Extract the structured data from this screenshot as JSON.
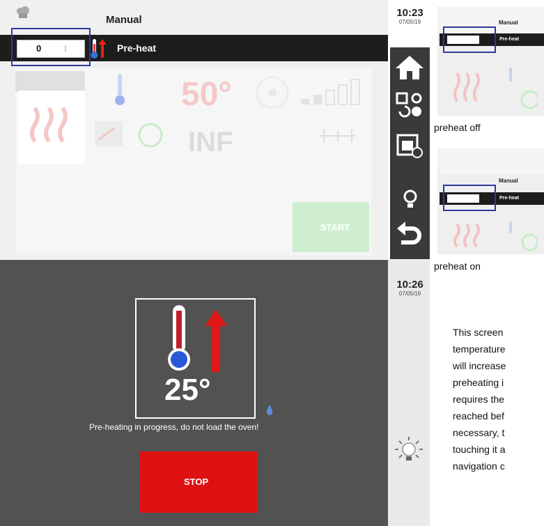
{
  "top_screen": {
    "title": "Manual",
    "preheat_label": "Pre-heat",
    "toggle": {
      "off_text": "0",
      "on_text": "I"
    },
    "faded_temperature": "50°",
    "faded_time": "INF",
    "faded_start": "START"
  },
  "clock_top": {
    "time": "10:23",
    "date": "07/05/19"
  },
  "clock_bottom": {
    "time": "10:26",
    "date": "07/05/19"
  },
  "bottom_screen": {
    "temperature": "25°",
    "message": "Pre-heating in progress, do not load the oven!",
    "stop_label": "STOP"
  },
  "thumbnails": [
    {
      "title": "Manual",
      "label": "Pre-heat",
      "caption": "preheat off"
    },
    {
      "title": "Manual",
      "label": "Pre-heat",
      "caption": "preheat on"
    }
  ],
  "description": [
    "This screen",
    "temperature",
    "will increase",
    "preheating i",
    "requires the",
    "reached bef",
    "necessary, t",
    "touching it a",
    "navigation c"
  ],
  "colors": {
    "accent_red": "#dd1111",
    "highlight_blue": "#2b3a9a",
    "dark_bar": "#1d1d1d",
    "sidebar": "#3a3a3a"
  }
}
